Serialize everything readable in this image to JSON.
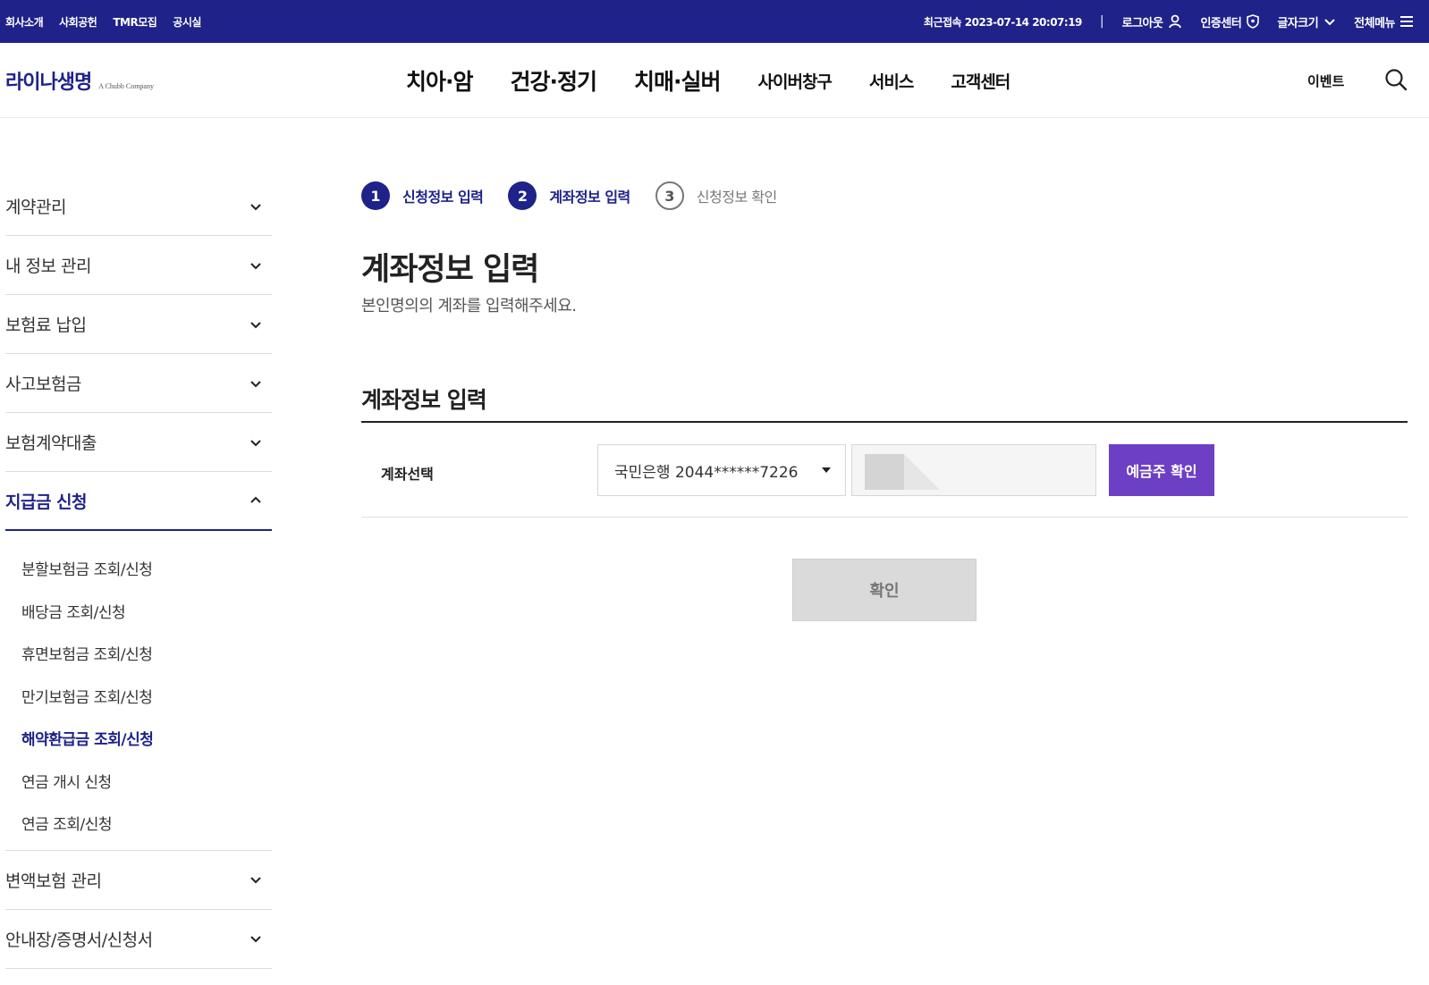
{
  "topbar": {
    "links": [
      "회사소개",
      "사회공헌",
      "TMR모집",
      "공시실"
    ],
    "last_login": "최근접속 2023-07-14 20:07:19",
    "separator": "|",
    "logout": "로그아웃",
    "cert": "인증센터",
    "font_size": "글자크기",
    "all_menu": "전체메뉴"
  },
  "header": {
    "brand": "라이나생명",
    "brand_sub": "A Chubb Company",
    "nav": [
      "치아·암",
      "건강·정기",
      "치매·실버",
      "사이버창구",
      "서비스",
      "고객센터"
    ],
    "event": "이벤트"
  },
  "sidebar": {
    "items_top": [
      "계약관리",
      "내 정보 관리",
      "보험료 납입",
      "사고보험금",
      "보험계약대출"
    ],
    "active": "지급금 신청",
    "sub_items": [
      "분할보험금 조회/신청",
      "배당금 조회/신청",
      "휴면보험금 조회/신청",
      "만기보험금 조회/신청",
      "해약환급금 조회/신청",
      "연금 개시 신청",
      "연금 조회/신청"
    ],
    "sub_active_index": 4,
    "items_bottom": [
      "변액보험 관리",
      "안내장/증명서/신청서"
    ]
  },
  "steps": [
    {
      "num": "1",
      "label": "신청정보 입력"
    },
    {
      "num": "2",
      "label": "계좌정보 입력"
    },
    {
      "num": "3",
      "label": "신청정보 확인"
    }
  ],
  "main": {
    "title": "계좌정보 입력",
    "desc": "본인명의의 계좌를 입력해주세요.",
    "section_title": "계좌정보 입력",
    "row_label": "계좌선택",
    "account_selected": "국민은행 2044******7226",
    "verify_button": "예금주 확인",
    "confirm_button": "확인"
  },
  "colors": {
    "brand_navy": "#1e2289",
    "accent_purple": "#6c3fc4",
    "disabled_gray": "#dadada"
  }
}
